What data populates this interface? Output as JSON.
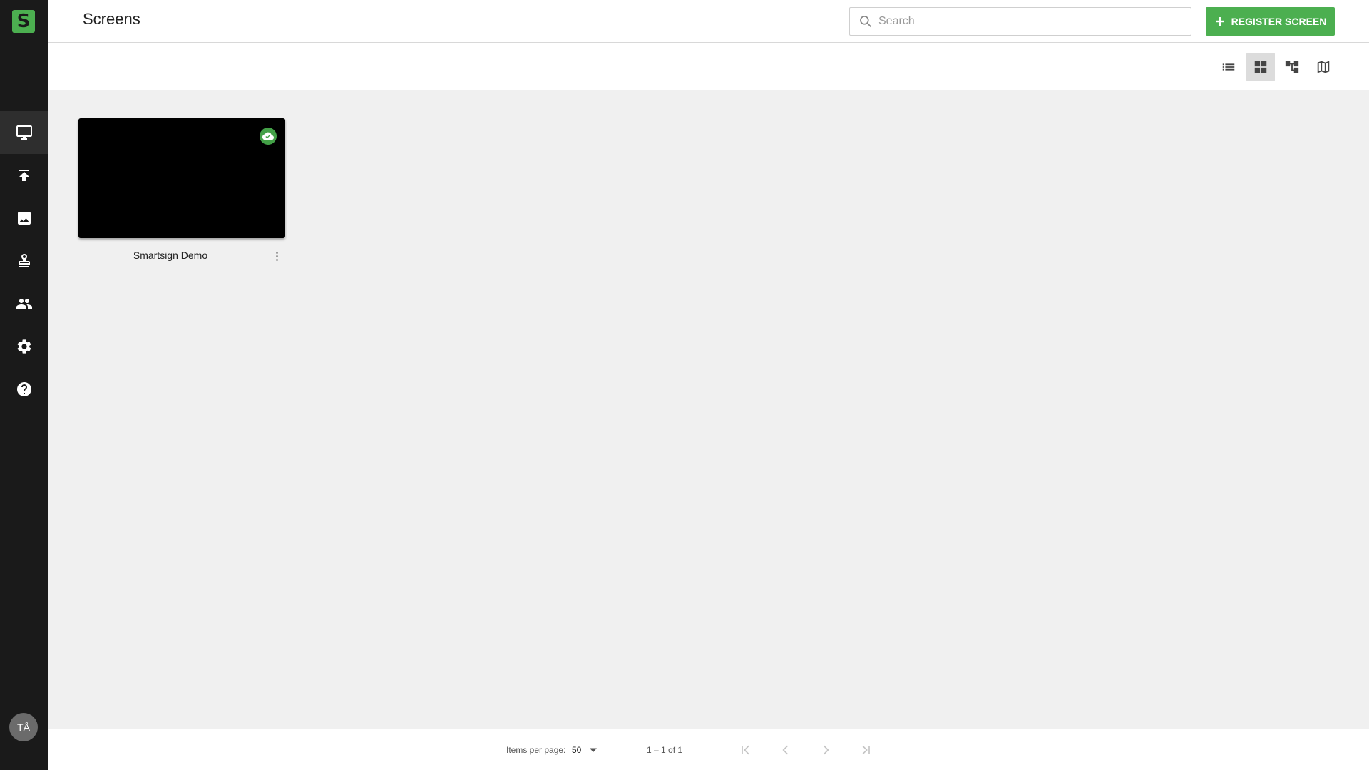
{
  "app": {
    "logo_letter": "S",
    "brand_color": "#4caf50"
  },
  "sidebar": {
    "items": [
      {
        "name": "screens",
        "icon": "monitor-icon",
        "active": true
      },
      {
        "name": "publish",
        "icon": "upload-icon",
        "active": false
      },
      {
        "name": "media",
        "icon": "image-icon",
        "active": false
      },
      {
        "name": "stamp",
        "icon": "stamp-icon",
        "active": false
      },
      {
        "name": "users",
        "icon": "people-icon",
        "active": false
      },
      {
        "name": "settings",
        "icon": "gear-icon",
        "active": false
      },
      {
        "name": "help",
        "icon": "help-icon",
        "active": false
      }
    ],
    "avatar_initials": "TÅ"
  },
  "header": {
    "title": "Screens",
    "search_placeholder": "Search",
    "register_button": "REGISTER SCREEN"
  },
  "toolbar": {
    "views": [
      {
        "name": "list",
        "icon": "list-icon",
        "active": false
      },
      {
        "name": "grid",
        "icon": "grid-icon",
        "active": true
      },
      {
        "name": "tree",
        "icon": "tree-icon",
        "active": false
      },
      {
        "name": "map",
        "icon": "map-icon",
        "active": false
      }
    ]
  },
  "screens": [
    {
      "name": "Smartsign Demo",
      "status_icon": "cloud-done-icon",
      "status_color": "#43a047"
    }
  ],
  "paginator": {
    "items_per_page_label": "Items per page:",
    "items_per_page_value": "50",
    "range_label": "1 – 1 of 1"
  }
}
